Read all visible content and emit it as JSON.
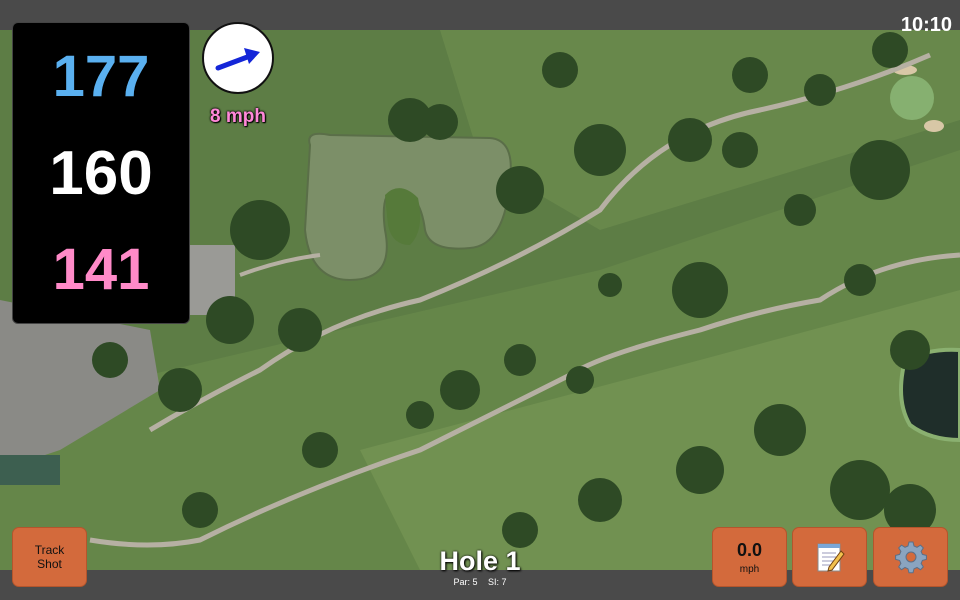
{
  "status_bar": {
    "time": "10:10"
  },
  "distances": {
    "back": "177",
    "middle": "160",
    "front": "141"
  },
  "wind": {
    "speed": "8 mph",
    "direction": "east-northeast"
  },
  "hole": {
    "title": "Hole 1",
    "par_label": "Par: 5",
    "si_label": "SI: 7"
  },
  "buttons": {
    "track_shot": {
      "line1": "Track",
      "line2": "Shot"
    },
    "speed": {
      "value": "0.0",
      "unit": "mph"
    },
    "notes_icon": "notepad-icon",
    "settings_icon": "gear-icon"
  },
  "colors": {
    "back": "#5ab0f0",
    "middle": "#ffffff",
    "front": "#ff8ac8",
    "wind_text": "#ff88d8",
    "button": "#d36a3c",
    "bars": "#4a4a4a"
  }
}
